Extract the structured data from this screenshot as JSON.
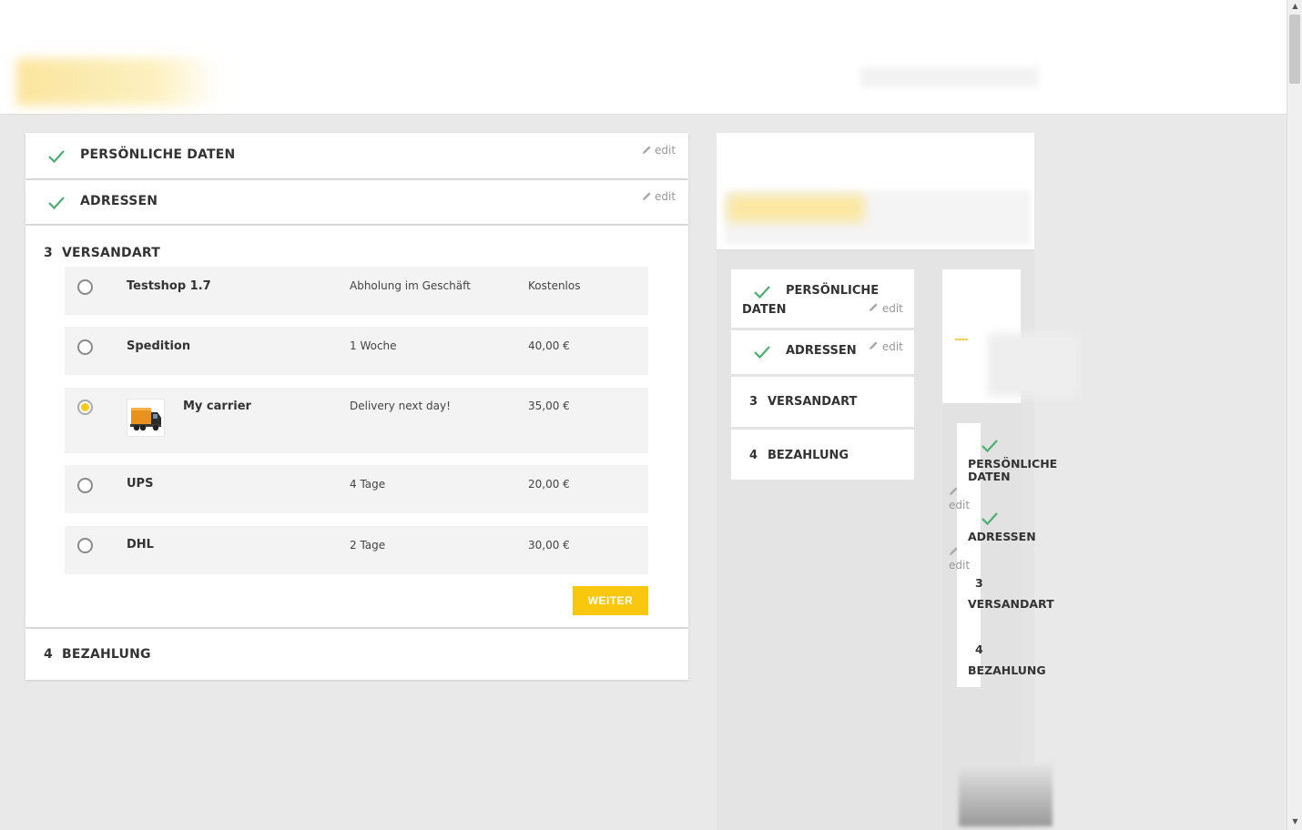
{
  "steps": {
    "personal": {
      "title": "PERSÖNLICHE DATEN",
      "edit": "edit"
    },
    "addresses": {
      "title": "ADRESSEN",
      "edit": "edit"
    },
    "shipping": {
      "number": "3",
      "title": "VERSANDART"
    },
    "payment": {
      "number": "4",
      "title": "BEZAHLUNG"
    }
  },
  "carriers": [
    {
      "name": "Testshop 1.7",
      "delay": "Abholung im Geschäft",
      "price": "Kostenlos",
      "selected": false
    },
    {
      "name": "Spedition",
      "delay": "1 Woche",
      "price": "40,00 €",
      "selected": false
    },
    {
      "name": "My carrier",
      "delay": "Delivery next day!",
      "price": "35,00 €",
      "selected": true,
      "logo": "truck-icon"
    },
    {
      "name": "UPS",
      "delay": "4 Tage",
      "price": "20,00 €",
      "selected": false
    },
    {
      "name": "DHL",
      "delay": "2 Tage",
      "price": "30,00 €",
      "selected": false
    }
  ],
  "continue_label": "WEITER",
  "mirror": {
    "personal_line1": "PERSÖNLICHE",
    "personal_line2": "DATEN",
    "addresses": "ADRESSEN",
    "shipping_number": "3",
    "shipping": "VERSANDART",
    "payment_number": "4",
    "payment": "BEZAHLUNG",
    "edit": "edit"
  },
  "tiny": {
    "personal_line1": "PERSÖNLICHE",
    "personal_line2": "DATEN",
    "addresses": "ADRESSEN",
    "shipping_number": "3",
    "shipping": "VERSANDART",
    "payment_number": "4",
    "payment": "BEZAHLUNG",
    "edit": "edit"
  },
  "colors": {
    "accent": "#f9c80e",
    "check": "#4cae6e",
    "panel": "#f3f3f3",
    "background": "#e9e9e9"
  }
}
